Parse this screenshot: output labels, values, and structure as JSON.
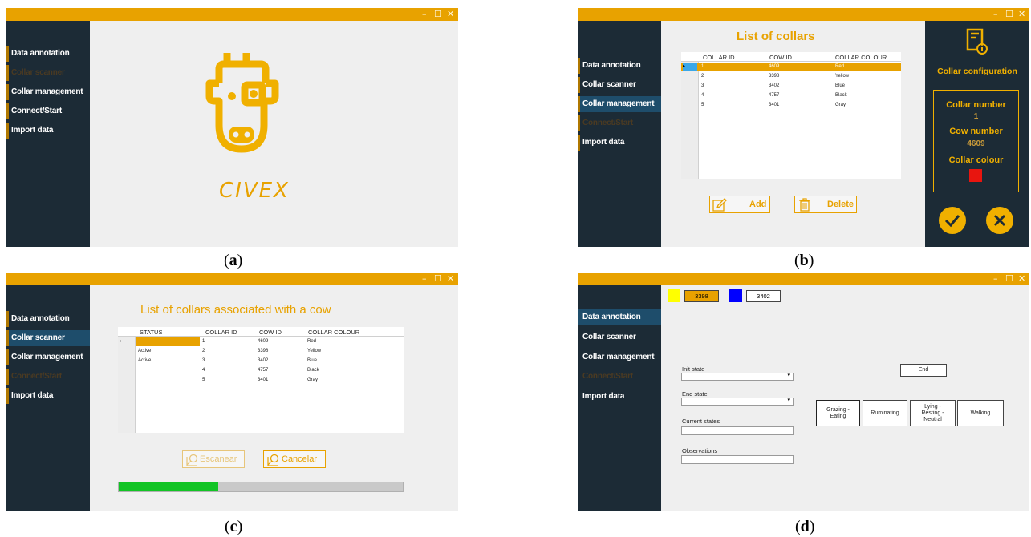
{
  "window_controls": {
    "minimize": "–",
    "maximize": "☐",
    "close": "✕"
  },
  "panel_a": {
    "caption_letter": "a",
    "nav": [
      "Data annotation",
      "Collar scanner",
      "Collar management",
      "Connect/Start",
      "Import data"
    ],
    "logo_text": "CIVEX",
    "logo_icon": "cow-head-icon"
  },
  "panel_b": {
    "caption_letter": "b",
    "nav": [
      "Data annotation",
      "Collar scanner",
      "Collar management",
      "Connect/Start",
      "Import data"
    ],
    "title": "List of collars",
    "columns": [
      "COLLAR ID",
      "COW ID",
      "COLLAR COLOUR"
    ],
    "rows": [
      [
        "1",
        "4609",
        "Red"
      ],
      [
        "2",
        "3398",
        "Yellow"
      ],
      [
        "3",
        "3402",
        "Blue"
      ],
      [
        "4",
        "4757",
        "Black"
      ],
      [
        "5",
        "3401",
        "Gray"
      ]
    ],
    "add_label": "Add",
    "delete_label": "Delete",
    "config_title": "Collar configuration",
    "collar_number_label": "Collar number",
    "collar_number_value": "1",
    "cow_number_label": "Cow number",
    "cow_number_value": "4609",
    "collar_colour_label": "Collar colour",
    "collar_colour_value": "#e8150f",
    "config_icon": "document-info-icon"
  },
  "panel_c": {
    "caption_letter": "c",
    "nav": [
      "Data annotation",
      "Collar scanner",
      "Collar management",
      "Connect/Start",
      "Import data"
    ],
    "title": "List of collars associated with a cow",
    "columns": [
      "STATUS",
      "COLLAR ID",
      "COW ID",
      "COLLAR COLOUR"
    ],
    "rows": [
      [
        "",
        "1",
        "4609",
        "Red"
      ],
      [
        "Active",
        "2",
        "3398",
        "Yellow"
      ],
      [
        "Active",
        "3",
        "3402",
        "Blue"
      ],
      [
        "",
        "4",
        "4757",
        "Black"
      ],
      [
        "",
        "5",
        "3401",
        "Gray"
      ]
    ],
    "scan_label": "Escanear",
    "cancel_label": "Cancelar",
    "progress": 0.35
  },
  "panel_d": {
    "caption_letter": "d",
    "nav": [
      "Data annotation",
      "Collar scanner",
      "Collar management",
      "Connect/Start",
      "Import data"
    ],
    "cow_tags": [
      {
        "color": "#ffff00",
        "id": "3398"
      },
      {
        "color": "#0000ff",
        "id": "3402"
      }
    ],
    "init_state_label": "Init state",
    "end_state_label": "End state",
    "current_states_label": "Current states",
    "observations_label": "Observations",
    "end_button": "End",
    "states": [
      "Grazing -\nEating",
      "Ruminating",
      "Lying -\nResting -\nNeutral",
      "Walking"
    ]
  },
  "colors": {
    "accent": "#e8a200",
    "sidebar": "#1c2b36",
    "active_nav": "#1e4d6b"
  }
}
